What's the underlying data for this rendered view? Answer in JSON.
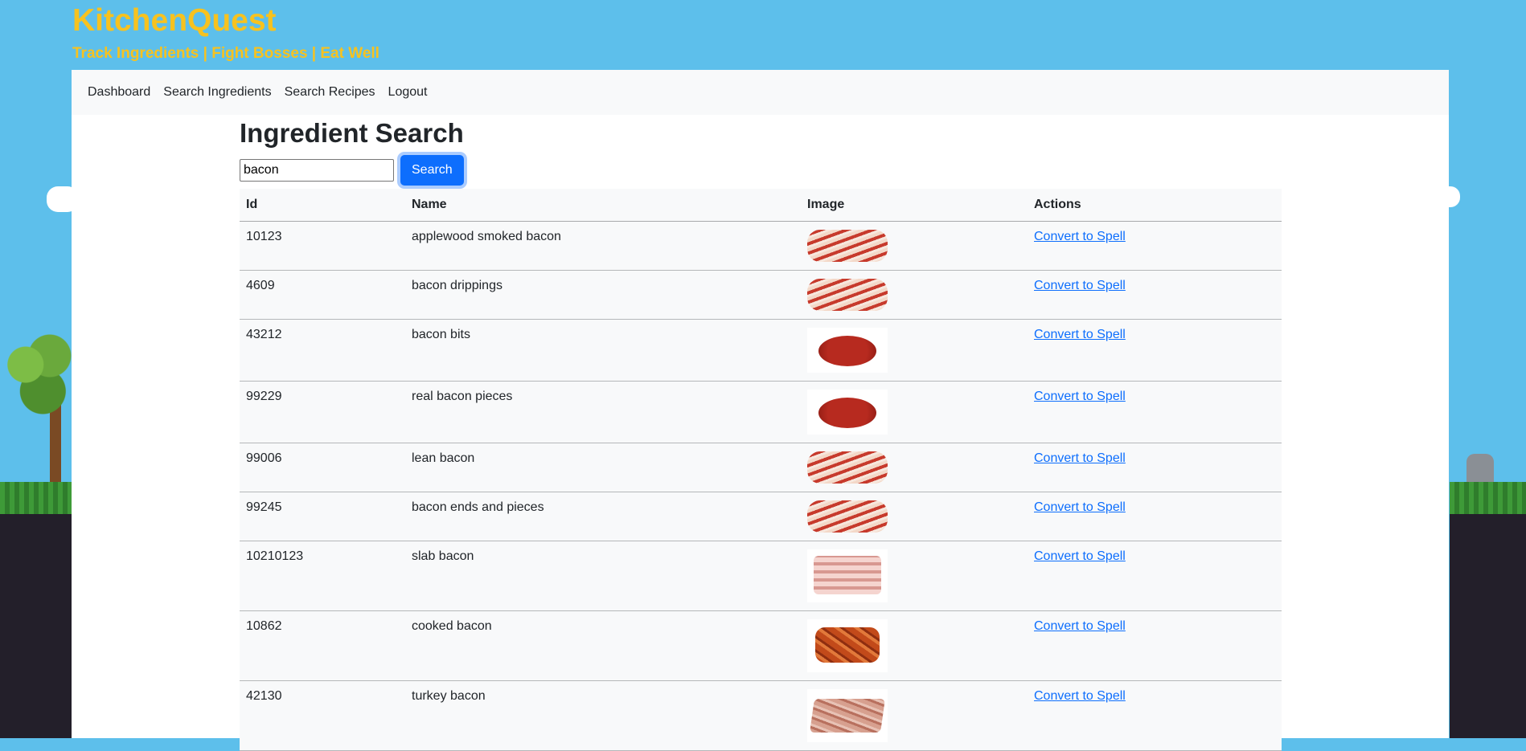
{
  "header": {
    "title": "KitchenQuest",
    "tagline": "Track Ingredients | Fight Bosses | Eat Well"
  },
  "nav": {
    "items": [
      "Dashboard",
      "Search Ingredients",
      "Search Recipes",
      "Logout"
    ]
  },
  "page": {
    "title": "Ingredient Search"
  },
  "search": {
    "value": "bacon",
    "button_label": "Search"
  },
  "table": {
    "headers": [
      "Id",
      "Name",
      "Image",
      "Actions"
    ],
    "rows": [
      {
        "id": "10123",
        "name": "applewood smoked bacon",
        "image": "bacon-strips",
        "action": "Convert to Spell"
      },
      {
        "id": "4609",
        "name": "bacon drippings",
        "image": "bacon-strips",
        "action": "Convert to Spell"
      },
      {
        "id": "43212",
        "name": "bacon bits",
        "image": "bacon-bits",
        "action": "Convert to Spell"
      },
      {
        "id": "99229",
        "name": "real bacon pieces",
        "image": "bacon-bits",
        "action": "Convert to Spell"
      },
      {
        "id": "99006",
        "name": "lean bacon",
        "image": "bacon-strips",
        "action": "Convert to Spell"
      },
      {
        "id": "99245",
        "name": "bacon ends and pieces",
        "image": "bacon-strips",
        "action": "Convert to Spell"
      },
      {
        "id": "10210123",
        "name": "slab bacon",
        "image": "slab-bacon",
        "action": "Convert to Spell"
      },
      {
        "id": "10862",
        "name": "cooked bacon",
        "image": "cooked-bacon",
        "action": "Convert to Spell"
      },
      {
        "id": "42130",
        "name": "turkey bacon",
        "image": "turkey-bacon",
        "action": "Convert to Spell"
      }
    ]
  },
  "colors": {
    "sky": "#5dbfeb",
    "brand": "#f7c21f",
    "primary": "#0d6efd"
  }
}
